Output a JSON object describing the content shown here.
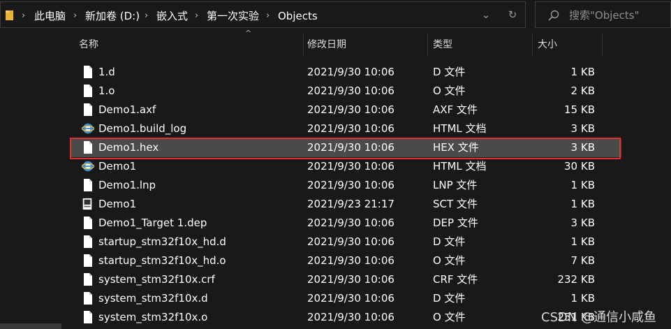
{
  "address_bar": {
    "breadcrumbs": [
      "此电脑",
      "新加卷 (D:)",
      "嵌入式",
      "第一次实验",
      "Objects"
    ]
  },
  "search": {
    "placeholder": "搜索\"Objects\""
  },
  "columns": {
    "name": "名称",
    "date": "修改日期",
    "type": "类型",
    "size": "大小"
  },
  "files": [
    {
      "name": "1.d",
      "date": "2021/9/30 10:06",
      "type": "D 文件",
      "size": "1 KB",
      "icon": "file-icon"
    },
    {
      "name": "1.o",
      "date": "2021/9/30 10:06",
      "type": "O 文件",
      "size": "2 KB",
      "icon": "file-icon"
    },
    {
      "name": "Demo1.axf",
      "date": "2021/9/30 10:06",
      "type": "AXF 文件",
      "size": "15 KB",
      "icon": "file-icon"
    },
    {
      "name": "Demo1.build_log",
      "date": "2021/9/30 10:06",
      "type": "HTML 文档",
      "size": "3 KB",
      "icon": "ie-html-icon"
    },
    {
      "name": "Demo1.hex",
      "date": "2021/9/30 10:06",
      "type": "HEX 文件",
      "size": "3 KB",
      "icon": "file-icon",
      "selected": true
    },
    {
      "name": "Demo1",
      "date": "2021/9/30 10:06",
      "type": "HTML 文档",
      "size": "30 KB",
      "icon": "ie-html-icon"
    },
    {
      "name": "Demo1.lnp",
      "date": "2021/9/30 10:06",
      "type": "LNP 文件",
      "size": "1 KB",
      "icon": "file-icon"
    },
    {
      "name": "Demo1",
      "date": "2021/9/23 21:17",
      "type": "SCT 文件",
      "size": "1 KB",
      "icon": "sct-icon"
    },
    {
      "name": "Demo1_Target 1.dep",
      "date": "2021/9/30 10:06",
      "type": "DEP 文件",
      "size": "3 KB",
      "icon": "file-icon"
    },
    {
      "name": "startup_stm32f10x_hd.d",
      "date": "2021/9/30 10:06",
      "type": "D 文件",
      "size": "1 KB",
      "icon": "file-icon"
    },
    {
      "name": "startup_stm32f10x_hd.o",
      "date": "2021/9/30 10:06",
      "type": "O 文件",
      "size": "7 KB",
      "icon": "file-icon"
    },
    {
      "name": "system_stm32f10x.crf",
      "date": "2021/9/30 10:06",
      "type": "CRF 文件",
      "size": "232 KB",
      "icon": "file-icon"
    },
    {
      "name": "system_stm32f10x.d",
      "date": "2021/9/30 10:06",
      "type": "D 文件",
      "size": "1 KB",
      "icon": "file-icon"
    },
    {
      "name": "system_stm32f10x.o",
      "date": "2021/9/30 10:06",
      "type": "O 文件",
      "size": "251 KB",
      "icon": "file-icon"
    }
  ],
  "watermark": "CSDN @通信小咸鱼",
  "colors": {
    "background": "#191919",
    "selected_row": "#4a4a4a",
    "highlight_border": "#e03030"
  }
}
